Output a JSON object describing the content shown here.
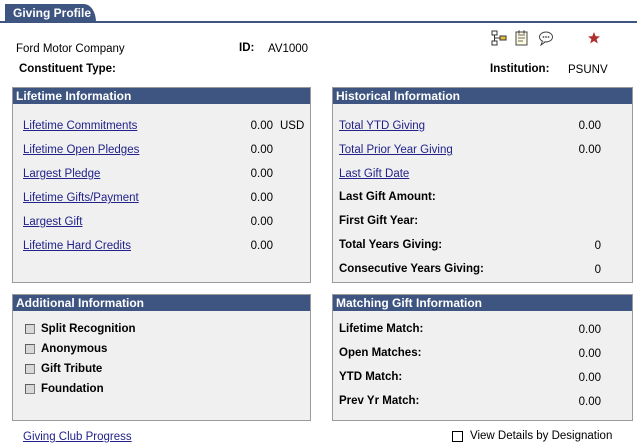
{
  "tab": {
    "label": "Giving Profile"
  },
  "header": {
    "company": "Ford Motor Company",
    "id_label": "ID:",
    "id_value": "AV1000",
    "constituent_type_label": "Constituent Type:",
    "institution_label": "Institution:",
    "institution_value": "PSUNV"
  },
  "toolbar": {
    "icons": [
      "diagram-icon",
      "notepad-icon",
      "comment-icon",
      "star-icon"
    ],
    "star_color": "#b03030"
  },
  "lifetime": {
    "title": "Lifetime Information",
    "rows": [
      {
        "label": "Lifetime Commitments",
        "value": "0.00",
        "unit": "USD"
      },
      {
        "label": "Lifetime Open Pledges",
        "value": "0.00"
      },
      {
        "label": "Largest Pledge",
        "value": "0.00"
      },
      {
        "label": "Lifetime Gifts/Payment",
        "value": "0.00"
      },
      {
        "label": "Largest Gift",
        "value": "0.00"
      },
      {
        "label": "Lifetime Hard Credits",
        "value": "0.00"
      }
    ]
  },
  "historical": {
    "title": "Historical Information",
    "rows": [
      {
        "label": "Total YTD Giving",
        "value": "0.00"
      },
      {
        "label": "Total Prior Year Giving",
        "value": "0.00"
      },
      {
        "label": "Last Gift Date",
        "value": ""
      },
      {
        "label": "Last Gift Amount:",
        "value": ""
      },
      {
        "label": "First Gift Year:",
        "value": ""
      },
      {
        "label": "Total Years Giving:",
        "value": "0"
      },
      {
        "label": "Consecutive Years Giving:",
        "value": "0"
      }
    ]
  },
  "additional": {
    "title": "Additional Information",
    "items": [
      "Split Recognition",
      "Anonymous",
      "Gift Tribute",
      "Foundation"
    ]
  },
  "matching": {
    "title": "Matching Gift Information",
    "rows": [
      {
        "label": "Lifetime Match:",
        "value": "0.00"
      },
      {
        "label": "Open Matches:",
        "value": "0.00"
      },
      {
        "label": "YTD Match:",
        "value": "0.00"
      },
      {
        "label": "Prev Yr Match:",
        "value": "0.00"
      }
    ]
  },
  "footer": {
    "giving_club_link": "Giving Club Progress",
    "view_details_label": "View Details by Designation"
  }
}
